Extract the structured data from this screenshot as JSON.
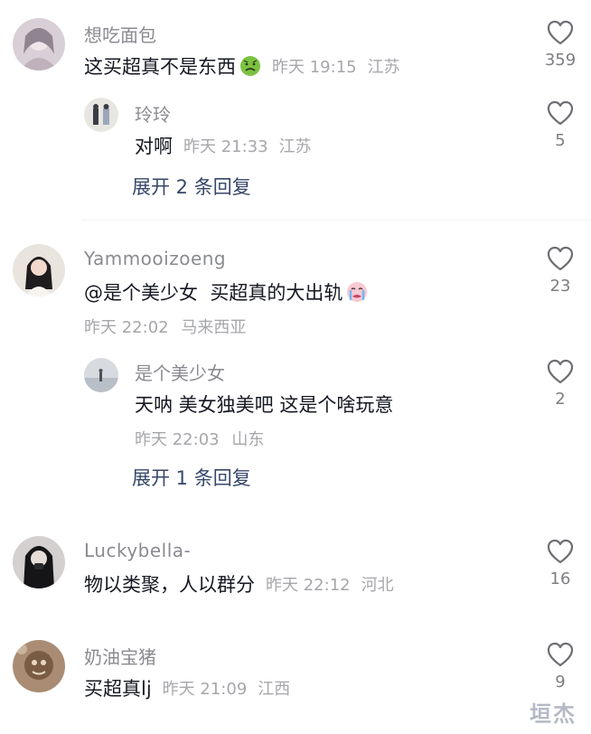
{
  "comments": [
    {
      "username": "想吃面包",
      "text": "这买超真不是东西",
      "time": "昨天 19:15",
      "location": "江苏",
      "likes": "359",
      "replies": [
        {
          "username": "玲玲",
          "text": "对啊",
          "time": "昨天 21:33",
          "location": "江苏",
          "likes": "5"
        }
      ],
      "expand_label": "展开 2 条回复"
    },
    {
      "username": "Yammooizoeng",
      "text": "@是个美少女  买超真的大出轨",
      "time": "昨天 22:02",
      "location": "马来西亚",
      "likes": "23",
      "replies": [
        {
          "username": "是个美少女",
          "text": "天呐 美女独美吧 这是个啥玩意",
          "time": "昨天 22:03",
          "location": "山东",
          "likes": "2"
        }
      ],
      "expand_label": "展开 1 条回复"
    },
    {
      "username": "Luckybella-",
      "text": "物以类聚，人以群分",
      "time": "昨天 22:12",
      "location": "河北",
      "likes": "16"
    },
    {
      "username": "奶油宝猪",
      "text": "买超真lj",
      "time": "昨天 21:09",
      "location": "江西",
      "likes": "9"
    }
  ],
  "icons": {
    "like": "heart-outline-icon",
    "emoji_1": "nauseated-face-emoji",
    "emoji_2": "crying-face-emoji"
  },
  "watermark": "垣杰",
  "colors": {
    "text": "#161823",
    "username": "#8a8b91",
    "meta": "#a6a7ab",
    "link": "#36476a"
  }
}
